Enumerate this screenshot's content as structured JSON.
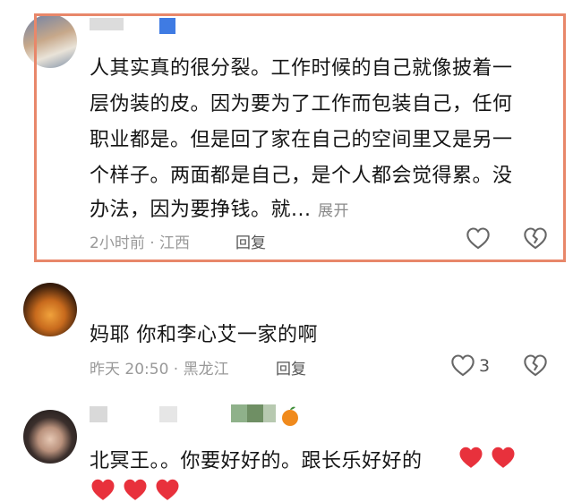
{
  "comments": [
    {
      "lines": [
        "人其实真的很分裂。工作时候的自己就像披着一",
        "层伪装的皮。因为要为了工作而包装自己，任何",
        "职业都是。但是回了家在自己的空间里又是另一",
        "个样子。两面都是自己，是个人都会觉得累。没"
      ],
      "last_line": "办法，因为要挣钱。就...",
      "more": "展开",
      "meta": "2小时前 · 江西",
      "reply": "回复"
    },
    {
      "text": "妈耶 你和李心艾一家的啊",
      "meta": "昨天 20:50 · 黑龙江",
      "reply": "回复",
      "likes": "3"
    },
    {
      "text": "北冥王。。你要好好的。跟长乐好好的"
    }
  ],
  "icons": {
    "like": "heart-outline-icon",
    "dislike": "broken-heart-icon",
    "emoji_heart": "red-heart-emoji",
    "emoji_orange": "orange-emoji"
  },
  "colors": {
    "highlight": "#e8876a",
    "heart": "#e8313c"
  }
}
